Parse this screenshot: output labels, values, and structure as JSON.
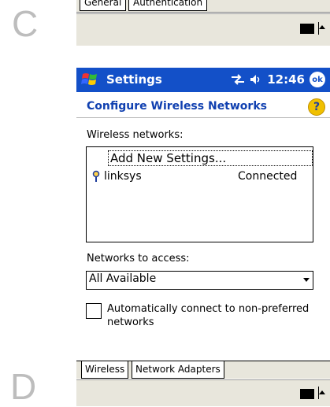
{
  "labels": {
    "frame_top": "C",
    "frame_bottom": "D"
  },
  "top_frame": {
    "tabs": [
      "General",
      "Authentication"
    ],
    "keyboard_icon": "keyboard-icon"
  },
  "titlebar": {
    "title": "Settings",
    "time": "12:46",
    "ok": "ok",
    "icons": [
      "windows-logo-icon",
      "connectivity-icon",
      "volume-icon"
    ]
  },
  "header": {
    "subtitle": "Configure Wireless Networks",
    "help_icon": "help-icon"
  },
  "wireless_label": "Wireless networks:",
  "networks": {
    "add_new": "Add New Settings...",
    "items": [
      {
        "name": "linksys",
        "status": "Connected",
        "icon": "key-icon"
      }
    ]
  },
  "access_label": "Networks to access:",
  "access_select": {
    "value": "All Available"
  },
  "auto_connect": {
    "label": "Automatically connect to non-preferred networks",
    "checked": false
  },
  "bottom_tabs": [
    "Wireless",
    "Network Adapters"
  ],
  "colors": {
    "titlebar": "#1350c8",
    "accent_text": "#1040b0",
    "chrome": "#e8e6dc"
  }
}
